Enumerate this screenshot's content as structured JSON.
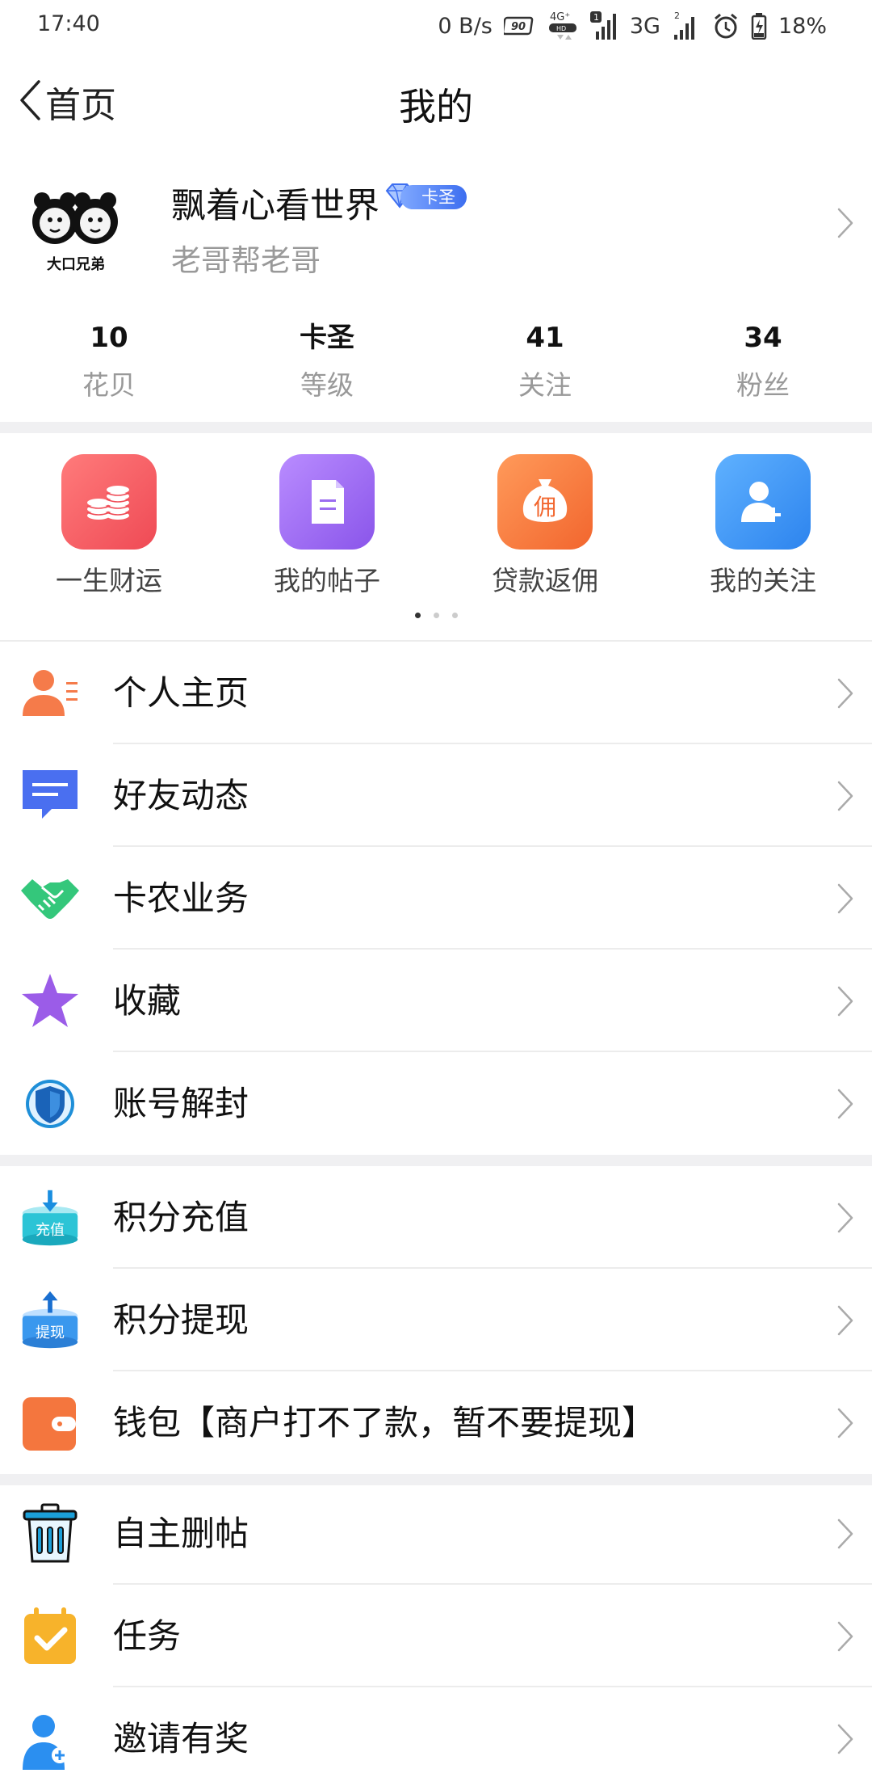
{
  "status_bar": {
    "time": "17:40",
    "net_speed": "0 B/s",
    "refresh_rate_badge": "90Hz",
    "network_hd": "4G+ HD",
    "sim1_badge": "1",
    "network_2": "3G",
    "sim2_badge": "2",
    "battery": "18%",
    "icons": [
      "refresh-rate-icon",
      "volte-icon",
      "signal-icon",
      "signal-icon",
      "alarm-icon",
      "battery-icon"
    ]
  },
  "header": {
    "back_label": "首页",
    "title": "我的"
  },
  "profile": {
    "username": "飘着心看世界",
    "vip_level": "卡圣",
    "signature": "老哥帮老哥",
    "avatar_caption": "大口兄弟"
  },
  "stats": [
    {
      "value": "10",
      "label": "花贝"
    },
    {
      "value": "卡圣",
      "label": "等级"
    },
    {
      "value": "41",
      "label": "关注"
    },
    {
      "value": "34",
      "label": "粉丝"
    }
  ],
  "quick_actions": {
    "items": [
      {
        "label": "一生财运",
        "icon": "coins-icon",
        "color": "#f2545b"
      },
      {
        "label": "我的帖子",
        "icon": "document-icon",
        "color": "#9b6cf0"
      },
      {
        "label": "贷款返佣",
        "icon": "money-bag-icon",
        "color": "#f5773a",
        "glyph": "佣"
      },
      {
        "label": "我的关注",
        "icon": "add-user-icon",
        "color": "#3d94f2"
      }
    ],
    "page_count": 3,
    "active_page": 1
  },
  "menu_group_1": [
    {
      "label": "个人主页",
      "icon": "person-card-icon"
    },
    {
      "label": "好友动态",
      "icon": "chat-bubble-icon"
    },
    {
      "label": "卡农业务",
      "icon": "handshake-icon"
    },
    {
      "label": "收藏",
      "icon": "star-icon"
    },
    {
      "label": "账号解封",
      "icon": "shield-icon"
    }
  ],
  "menu_group_2": [
    {
      "label": "积分充值",
      "icon": "recharge-icon",
      "badge": "充值"
    },
    {
      "label": "积分提现",
      "icon": "withdraw-icon",
      "badge": "提现"
    },
    {
      "label": "钱包【商户打不了款，暂不要提现】",
      "icon": "wallet-icon"
    }
  ],
  "menu_group_3": [
    {
      "label": "自主删帖",
      "icon": "trash-icon"
    },
    {
      "label": "任务",
      "icon": "task-calendar-icon"
    },
    {
      "label": "邀请有奖",
      "icon": "invite-icon"
    }
  ],
  "colors": {
    "accent_blue": "#3d6ef0",
    "divider": "#f0f0f2",
    "muted_text": "#999999"
  }
}
